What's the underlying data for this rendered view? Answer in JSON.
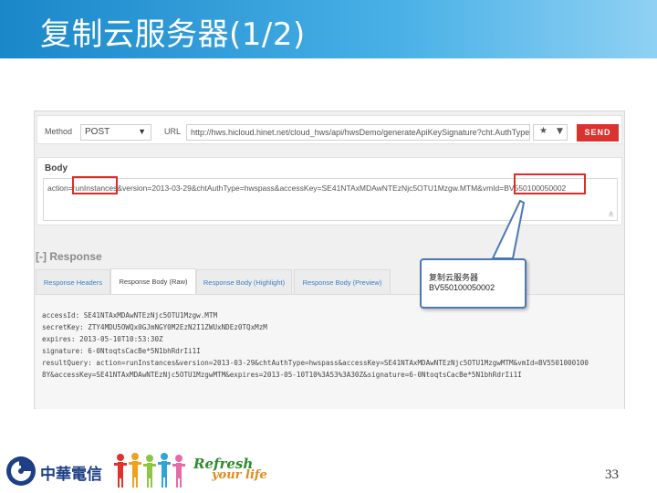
{
  "slide": {
    "title": "复制云服务器(1/2)",
    "page_number": "33"
  },
  "request": {
    "method_label": "Method",
    "method_value": "POST",
    "url_label": "URL",
    "url_value": "http://hws.hicloud.hinet.net/cloud_hws/api/hwsDemo/generateApiKeySignature?cht.AuthType=...",
    "send_label": "SEND"
  },
  "body": {
    "label": "Body",
    "text": "action=runInstances&version=2013-03-29&chtAuthType=hwspass&accessKey=SE41NTAxMDAwNTEzNjc5OTU1Mzgw.MTM&vmId=BV550100050002"
  },
  "response": {
    "title": "[-] Response",
    "tabs": [
      {
        "label": "Response Headers"
      },
      {
        "label": "Response Body (Raw)"
      },
      {
        "label": "Response Body (Highlight)"
      },
      {
        "label": "Response Body (Preview)"
      }
    ],
    "lines": [
      "accessId: SE41NTAxMDAwNTEzNjc5OTU1Mzgw.MTM",
      "secretKey: ZTY4MDU5OWQx0GJmNGY0M2EzN2I1ZWUxNDEz0TQxMzM",
      "expires: 2013-05-10T10:53:30Z",
      "signature: 6-0NtoqtsCacBe*5N1bhRdrIi1I",
      "resultQuery: action=runInstances&version=2013-03-29&chtAuthType=hwspass&accessKey=SE41NTAxMDAwNTEzNjc5OTU1MzgwMTM&vmId=BV5501000100",
      "8Y&accessKey=SE41NTAxMDAwNTEzNjc5OTU1MzgwMTM&expires=2013-05-10T10%3A53%3A30Z&signature=6-0NtoqtsCacBe*5N1bhRdrIi1I"
    ]
  },
  "callout": {
    "line1": "复制云服务器",
    "line2": "BV550100050002"
  },
  "footer": {
    "company_name": "中華電信",
    "slogan_1": "Refresh",
    "slogan_2": "your life"
  },
  "colors": {
    "header_blue": "#1a87c9",
    "send_red": "#d9322f",
    "highlight_red": "#e02a2a",
    "callout_border": "#4a79b4"
  }
}
